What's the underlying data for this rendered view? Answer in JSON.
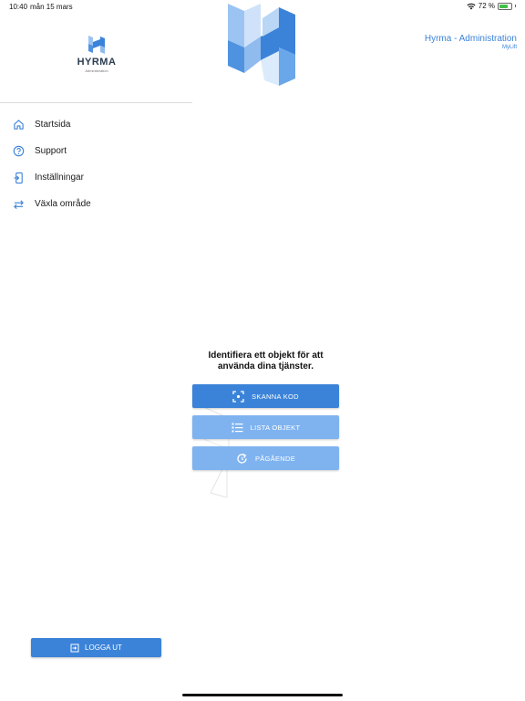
{
  "status_bar": {
    "time": "10:40",
    "date": "mån 15 mars",
    "battery_percent": "72 %",
    "battery_level": 0.72
  },
  "sidebar": {
    "logo_name": "HYRMA",
    "logo_sub": "Administration",
    "items": [
      {
        "label": "Startsida",
        "icon": "home-icon"
      },
      {
        "label": "Support",
        "icon": "help-icon"
      },
      {
        "label": "Inställningar",
        "icon": "settings-icon"
      },
      {
        "label": "Växla område",
        "icon": "swap-icon"
      }
    ],
    "logout_label": "LOGGA UT"
  },
  "header": {
    "title": "Hyrma - Administration",
    "subtitle": "MyLift"
  },
  "main": {
    "prompt": "Identifiera ett objekt för att använda dina tjänster.",
    "buttons": [
      {
        "label": "SKANNA KOD",
        "icon": "scan-icon"
      },
      {
        "label": "LISTA OBJEKT",
        "icon": "list-icon"
      },
      {
        "label": "PÅGÅENDE",
        "icon": "refresh-icon"
      }
    ]
  },
  "colors": {
    "accent": "#3b83d9",
    "accent_light": "#7fb3f0"
  }
}
